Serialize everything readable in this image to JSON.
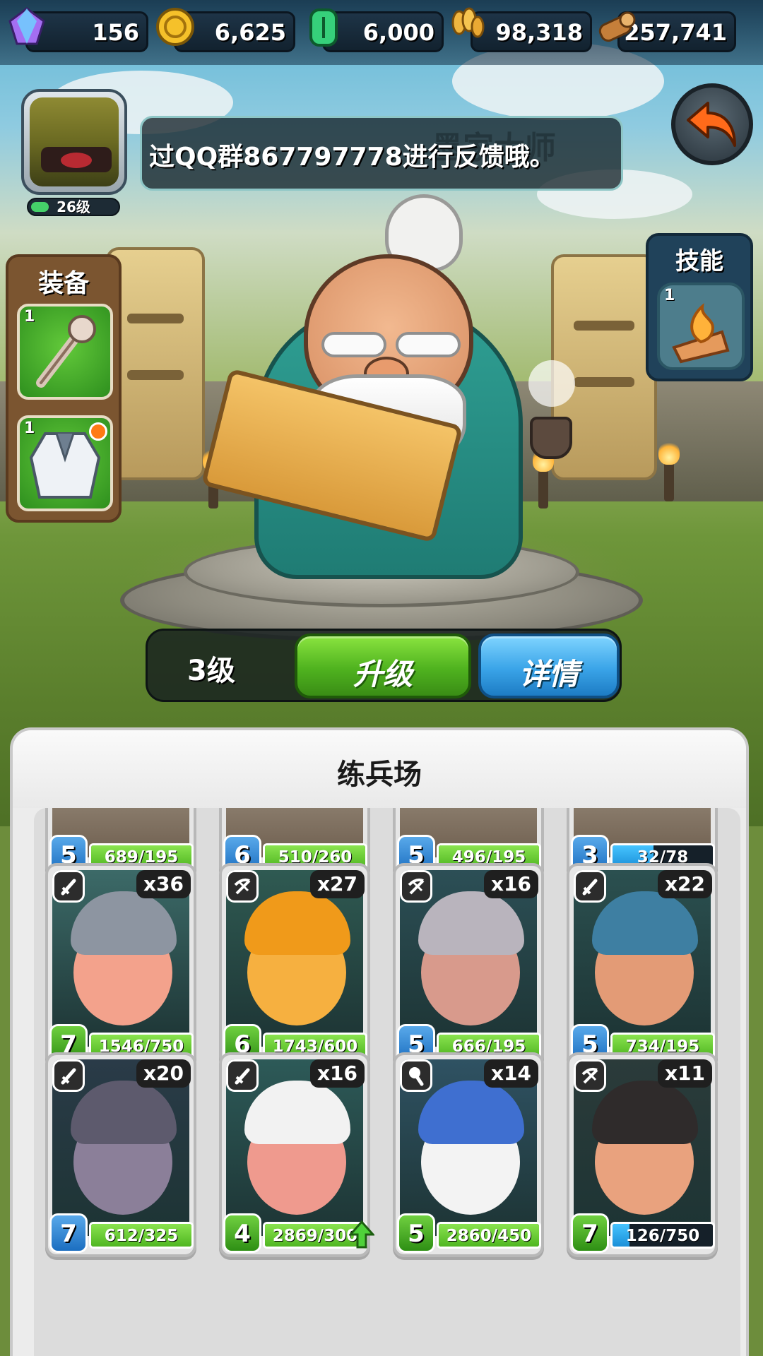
{
  "resources": [
    {
      "name": "gem",
      "icon": "gem-icon",
      "value": "156",
      "color": "#b06cf0"
    },
    {
      "name": "gold",
      "icon": "gold-coin-icon",
      "value": "6,625",
      "color": "#f2b824"
    },
    {
      "name": "jade",
      "icon": "jade-tablet-icon",
      "value": "6,000",
      "color": "#2fbf6a"
    },
    {
      "name": "grain",
      "icon": "wheat-icon",
      "value": "98,318",
      "color": "#e7b243"
    },
    {
      "name": "wood",
      "icon": "wood-log-icon",
      "value": "257,741",
      "color": "#c9843d"
    }
  ],
  "player": {
    "avatar_icon": "helmet-avatar-icon",
    "level_label": "26级",
    "level_progress": 0.2
  },
  "chat": {
    "ghost_text": "墨家大师",
    "message": "过QQ群867797778进行反馈哦。"
  },
  "equipment": {
    "title": "装备",
    "items": [
      {
        "icon": "staff-icon",
        "count": "1",
        "has_alert": false
      },
      {
        "icon": "robe-icon",
        "count": "1",
        "has_alert": true
      }
    ]
  },
  "skill": {
    "title": "技能",
    "count": "1",
    "icon": "flame-scroll-icon"
  },
  "hero": {
    "level": "3级",
    "upgrade_label": "升级",
    "detail_label": "详情"
  },
  "barracks": {
    "title": "练兵场",
    "units": [
      {
        "level": "5",
        "level_color": "blue",
        "progress": "689/195",
        "fill": 1.0,
        "bar": "green",
        "partial": true
      },
      {
        "level": "6",
        "level_color": "blue",
        "progress": "510/260",
        "fill": 1.0,
        "bar": "green",
        "partial": true
      },
      {
        "level": "5",
        "level_color": "blue",
        "progress": "496/195",
        "fill": 1.0,
        "bar": "green",
        "partial": true
      },
      {
        "level": "3",
        "level_color": "blue",
        "progress": "32/78",
        "fill": 0.41,
        "bar": "blue",
        "partial": true
      },
      {
        "class_icon": "sword-icon",
        "count": "x36",
        "level": "7",
        "level_color": "green",
        "progress": "1546/750",
        "fill": 1.0,
        "bar": "green",
        "skin": "#f3a28c",
        "gear": "#8d95a1",
        "bg": "#3c6a68"
      },
      {
        "class_icon": "crossbow-icon",
        "count": "x27",
        "level": "6",
        "level_color": "green",
        "progress": "1743/600",
        "fill": 1.0,
        "bar": "green",
        "skin": "#f6b040",
        "gear": "#f09a1a",
        "bg": "#2f5a52"
      },
      {
        "class_icon": "crossbow-icon",
        "count": "x16",
        "level": "5",
        "level_color": "blue",
        "progress": "666/195",
        "fill": 1.0,
        "bar": "green",
        "skin": "#d89a8c",
        "gear": "#b9b4bd",
        "bg": "#2c4f56"
      },
      {
        "class_icon": "sword-icon",
        "count": "x22",
        "level": "5",
        "level_color": "blue",
        "progress": "734/195",
        "fill": 1.0,
        "bar": "green",
        "skin": "#e39b76",
        "gear": "#3e7fa2",
        "bg": "#2b5050"
      },
      {
        "class_icon": "sword-icon",
        "count": "x20",
        "level": "7",
        "level_color": "blue",
        "progress": "612/325",
        "fill": 1.0,
        "bar": "green",
        "skin": "#8b7f99",
        "gear": "#5d5a6d",
        "bg": "#2a3b48"
      },
      {
        "class_icon": "sword-icon",
        "count": "x16",
        "level": "4",
        "level_color": "green",
        "progress": "2869/300",
        "fill": 1.0,
        "bar": "green",
        "skin": "#ef9a8e",
        "gear": "#f2f2f2",
        "bg": "#2d5a58",
        "upgradable": true
      },
      {
        "class_icon": "mace-icon",
        "count": "x14",
        "level": "5",
        "level_color": "green",
        "progress": "2860/450",
        "fill": 1.0,
        "bar": "green",
        "skin": "#f3f3f3",
        "gear": "#3f6fd0",
        "bg": "#2f5263"
      },
      {
        "class_icon": "crossbow-icon",
        "count": "x11",
        "level": "7",
        "level_color": "green",
        "progress": "126/750",
        "fill": 0.17,
        "bar": "blue",
        "skin": "#e9a27e",
        "gear": "#2f2b2b",
        "bg": "#2b3b3a"
      }
    ]
  }
}
